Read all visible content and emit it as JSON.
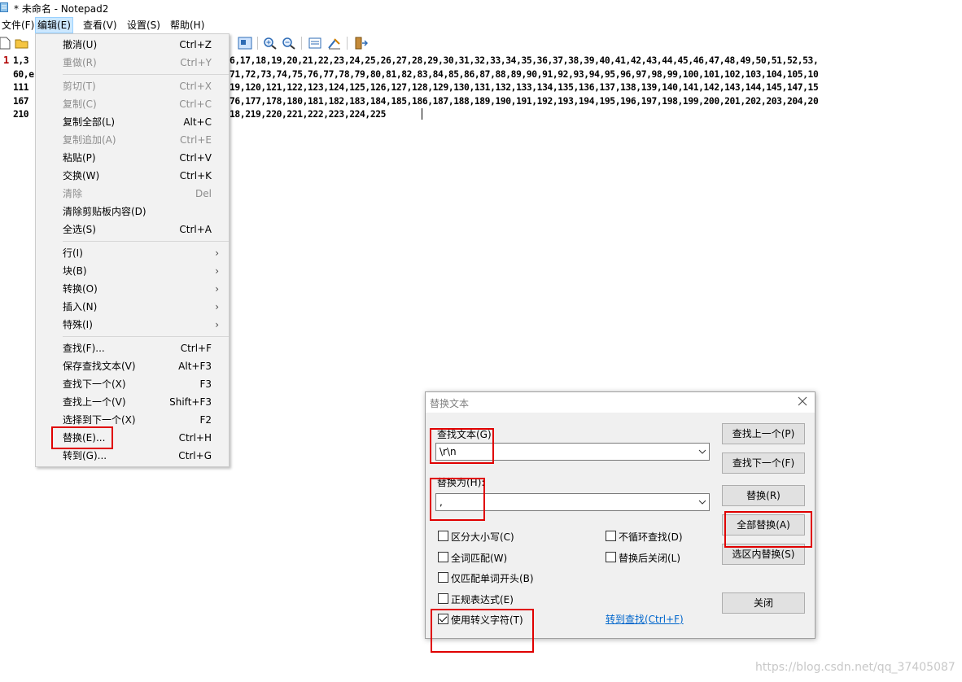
{
  "window": {
    "title": "* 未命名 - Notepad2",
    "icon": "notepad-icon"
  },
  "menubar": [
    {
      "label": "文件(F)"
    },
    {
      "label": "编辑(E)"
    },
    {
      "label": "查看(V)"
    },
    {
      "label": "设置(S)"
    },
    {
      "label": "帮助(H)"
    }
  ],
  "toolbar": {
    "icons": [
      "new-file-icon",
      "open-folder-icon",
      "view-icon",
      "zoom-in-icon",
      "zoom-out-icon",
      "scheme-icon",
      "customize-icon",
      "exit-icon"
    ]
  },
  "editor": {
    "line_number": "1",
    "lines": [
      "1,3",
      "60,e",
      "111",
      "167",
      "210"
    ],
    "lines_right": [
      "6,17,18,19,20,21,22,23,24,25,26,27,28,29,30,31,32,33,34,35,36,37,38,39,40,41,42,43,44,45,46,47,48,49,50,51,52,53,",
      "71,72,73,74,75,76,77,78,79,80,81,82,83,84,85,86,87,88,89,90,91,92,93,94,95,96,97,98,99,100,101,102,103,104,105,10",
      "19,120,121,122,123,124,125,126,127,128,129,130,131,132,133,134,135,136,137,138,139,140,141,142,143,144,145,147,15",
      "76,177,178,180,181,182,183,184,185,186,187,188,189,190,191,192,193,194,195,196,197,198,199,200,201,202,203,204,20",
      "18,219,220,221,222,223,224,225"
    ]
  },
  "edit_menu": {
    "items": [
      {
        "label": "撤消(U)",
        "shortcut": "Ctrl+Z"
      },
      {
        "label": "重做(R)",
        "shortcut": "Ctrl+Y"
      },
      {
        "label": "剪切(T)",
        "shortcut": "Ctrl+X"
      },
      {
        "label": "复制(C)",
        "shortcut": "Ctrl+C"
      },
      {
        "label": "复制全部(L)",
        "shortcut": "Alt+C"
      },
      {
        "label": "复制追加(A)",
        "shortcut": "Ctrl+E"
      },
      {
        "label": "粘贴(P)",
        "shortcut": "Ctrl+V"
      },
      {
        "label": "交换(W)",
        "shortcut": "Ctrl+K"
      },
      {
        "label": "清除",
        "shortcut": "Del"
      },
      {
        "label": "清除剪贴板内容(D)",
        "shortcut": ""
      },
      {
        "label": "全选(S)",
        "shortcut": "Ctrl+A"
      },
      {
        "label": "行(I)",
        "shortcut": ""
      },
      {
        "label": "块(B)",
        "shortcut": ""
      },
      {
        "label": "转换(O)",
        "shortcut": ""
      },
      {
        "label": "插入(N)",
        "shortcut": ""
      },
      {
        "label": "特殊(I)",
        "shortcut": ""
      },
      {
        "label": "查找(F)...",
        "shortcut": "Ctrl+F"
      },
      {
        "label": "保存查找文本(V)",
        "shortcut": "Alt+F3"
      },
      {
        "label": "查找下一个(X)",
        "shortcut": "F3"
      },
      {
        "label": "查找上一个(V)",
        "shortcut": "Shift+F3"
      },
      {
        "label": "选择到下一个(X)",
        "shortcut": "F2"
      },
      {
        "label": "替换(E)...",
        "shortcut": "Ctrl+H"
      },
      {
        "label": "转到(G)...",
        "shortcut": "Ctrl+G"
      }
    ]
  },
  "dialog": {
    "title": "替换文本",
    "find_label": "查找文本(G):",
    "find_value": "\\r\\n",
    "replace_label": "替换为(H):",
    "replace_value": ",",
    "buttons": {
      "find_prev": "查找上一个(P)",
      "find_next": "查找下一个(F)",
      "replace": "替换(R)",
      "replace_all": "全部替换(A)",
      "replace_in_selection": "选区内替换(S)",
      "close": "关闭"
    },
    "options": {
      "match_case": {
        "label": "区分大小写(C)",
        "checked": false
      },
      "whole_word": {
        "label": "全词匹配(W)",
        "checked": false
      },
      "word_start": {
        "label": "仅匹配单词开头(B)",
        "checked": false
      },
      "regex": {
        "label": "正规表达式(E)",
        "checked": false
      },
      "escape": {
        "label": "使用转义字符(T)",
        "checked": true
      },
      "no_wrap": {
        "label": "不循环查找(D)",
        "checked": false
      },
      "close_after": {
        "label": "替换后关闭(L)",
        "checked": false
      }
    },
    "goto_link": "转到查找(Ctrl+F)"
  },
  "watermark": "https://blog.csdn.net/qq_37405087",
  "colors": {
    "highlight_red": "#e00000",
    "menu_active": "#cce8ff",
    "link_blue": "#0066cc"
  }
}
